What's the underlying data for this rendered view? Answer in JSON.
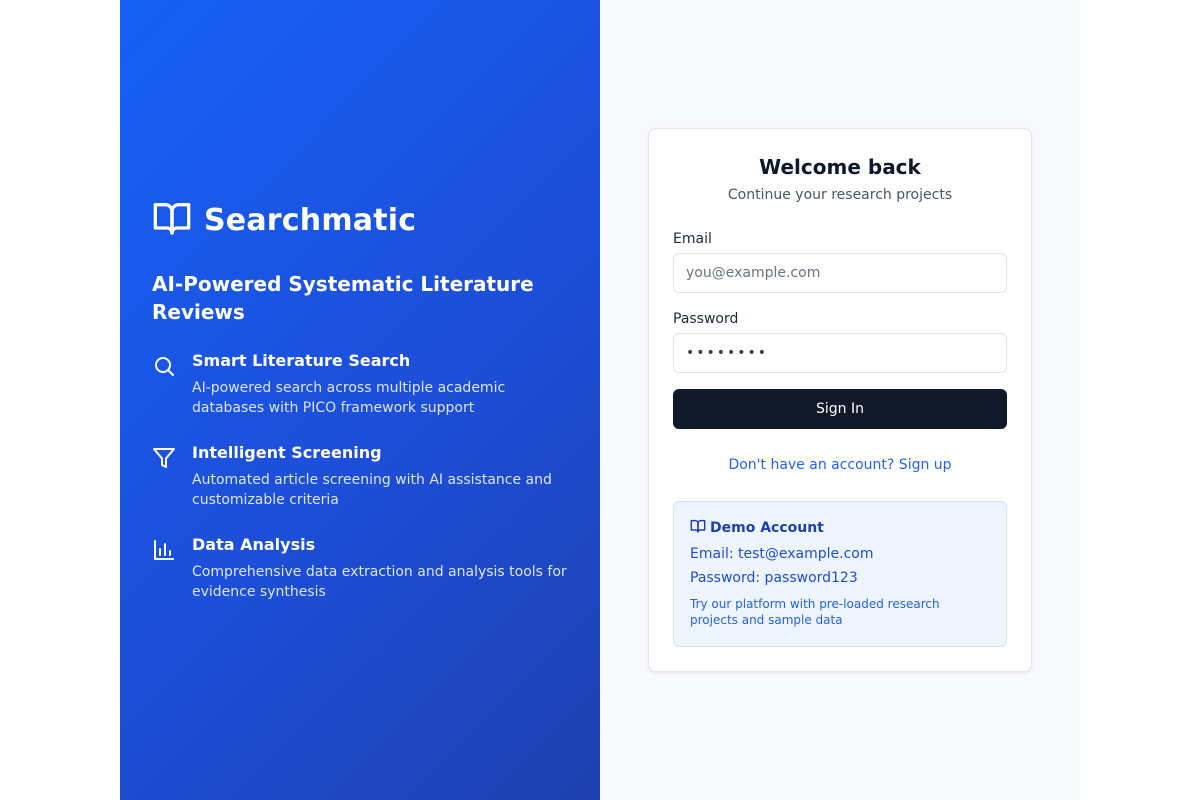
{
  "brand": {
    "name": "Searchmatic",
    "tagline": "AI-Powered Systematic Literature Reviews"
  },
  "features": [
    {
      "icon": "search-icon",
      "title": "Smart Literature Search",
      "desc": "AI-powered search across multiple academic databases with PICO framework support"
    },
    {
      "icon": "filter-icon",
      "title": "Intelligent Screening",
      "desc": "Automated article screening with AI assistance and customizable criteria"
    },
    {
      "icon": "bar-chart-icon",
      "title": "Data Analysis",
      "desc": "Comprehensive data extraction and analysis tools for evidence synthesis"
    }
  ],
  "login": {
    "title": "Welcome back",
    "subtitle": "Continue your research projects",
    "email_label": "Email",
    "email_placeholder": "you@example.com",
    "password_label": "Password",
    "password_value": "••••••••",
    "submit_label": "Sign In",
    "signup_link": "Don't have an account? Sign up"
  },
  "demo": {
    "icon": "book-open-icon",
    "heading": "Demo Account",
    "email_line": "Email: test@example.com",
    "password_line": "Password: password123",
    "note": "Try our platform with pre-loaded research projects and sample data"
  },
  "colors": {
    "brand_blue": "#1d4ed8",
    "button_dark": "#111827",
    "link_blue": "#2563eb",
    "demo_bg": "#eef5ff"
  }
}
